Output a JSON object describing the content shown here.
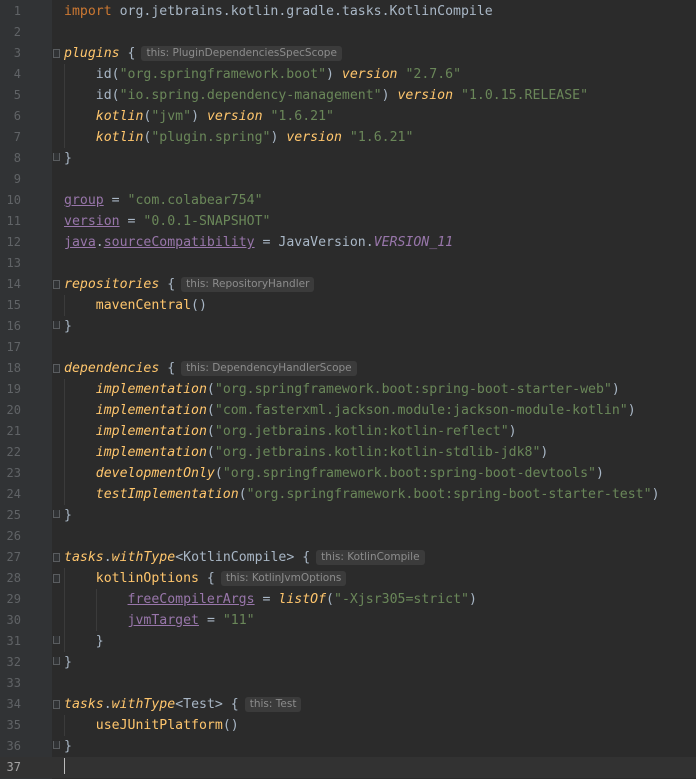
{
  "editor": {
    "caret_line": 37,
    "lines": [
      {
        "n": "1",
        "code": [
          {
            "t": "import",
            "c": "kw"
          },
          {
            "t": " org.jetbrains.kotlin.gradle.tasks.KotlinCompile"
          }
        ]
      },
      {
        "n": "2",
        "code": []
      },
      {
        "n": "3",
        "code": [
          {
            "t": "plugins",
            "c": "ext"
          },
          {
            "t": " {"
          }
        ],
        "hint": "this: PluginDependenciesSpecScope"
      },
      {
        "n": "4",
        "code": [
          {
            "t": "    id("
          },
          {
            "t": "\"org.springframework.boot\"",
            "c": "str"
          },
          {
            "t": ") "
          },
          {
            "t": "version",
            "c": "ext"
          },
          {
            "t": " "
          },
          {
            "t": "\"2.7.6\"",
            "c": "str"
          }
        ]
      },
      {
        "n": "5",
        "code": [
          {
            "t": "    id("
          },
          {
            "t": "\"io.spring.dependency-management\"",
            "c": "str"
          },
          {
            "t": ") "
          },
          {
            "t": "version",
            "c": "ext"
          },
          {
            "t": " "
          },
          {
            "t": "\"1.0.15.RELEASE\"",
            "c": "str"
          }
        ]
      },
      {
        "n": "6",
        "code": [
          {
            "t": "    "
          },
          {
            "t": "kotlin",
            "c": "ext"
          },
          {
            "t": "("
          },
          {
            "t": "\"jvm\"",
            "c": "str"
          },
          {
            "t": ") "
          },
          {
            "t": "version",
            "c": "ext"
          },
          {
            "t": " "
          },
          {
            "t": "\"1.6.21\"",
            "c": "str"
          }
        ]
      },
      {
        "n": "7",
        "code": [
          {
            "t": "    "
          },
          {
            "t": "kotlin",
            "c": "ext"
          },
          {
            "t": "("
          },
          {
            "t": "\"plugin.spring\"",
            "c": "str"
          },
          {
            "t": ") "
          },
          {
            "t": "version",
            "c": "ext"
          },
          {
            "t": " "
          },
          {
            "t": "\"1.6.21\"",
            "c": "str"
          }
        ]
      },
      {
        "n": "8",
        "code": [
          {
            "t": "}"
          }
        ]
      },
      {
        "n": "9",
        "code": []
      },
      {
        "n": "10",
        "code": [
          {
            "t": "group",
            "c": "prop"
          },
          {
            "t": " = "
          },
          {
            "t": "\"com.colabear754\"",
            "c": "str"
          }
        ]
      },
      {
        "n": "11",
        "code": [
          {
            "t": "version",
            "c": "prop"
          },
          {
            "t": " = "
          },
          {
            "t": "\"0.0.1-SNAPSHOT\"",
            "c": "str"
          }
        ]
      },
      {
        "n": "12",
        "code": [
          {
            "t": "java",
            "c": "prop"
          },
          {
            "t": "."
          },
          {
            "t": "sourceCompatibility",
            "c": "prop"
          },
          {
            "t": " = JavaVersion."
          },
          {
            "t": "VERSION_11",
            "c": "konst"
          }
        ]
      },
      {
        "n": "13",
        "code": []
      },
      {
        "n": "14",
        "code": [
          {
            "t": "repositories",
            "c": "ext"
          },
          {
            "t": " {"
          }
        ],
        "hint": "this: RepositoryHandler"
      },
      {
        "n": "15",
        "code": [
          {
            "t": "    "
          },
          {
            "t": "mavenCentral",
            "c": "fn"
          },
          {
            "t": "()"
          }
        ]
      },
      {
        "n": "16",
        "code": [
          {
            "t": "}"
          }
        ]
      },
      {
        "n": "17",
        "code": []
      },
      {
        "n": "18",
        "code": [
          {
            "t": "dependencies",
            "c": "ext"
          },
          {
            "t": " {"
          }
        ],
        "hint": "this: DependencyHandlerScope"
      },
      {
        "n": "19",
        "code": [
          {
            "t": "    "
          },
          {
            "t": "implementation",
            "c": "ext"
          },
          {
            "t": "("
          },
          {
            "t": "\"org.springframework.boot:spring-boot-starter-web\"",
            "c": "str"
          },
          {
            "t": ")"
          }
        ]
      },
      {
        "n": "20",
        "code": [
          {
            "t": "    "
          },
          {
            "t": "implementation",
            "c": "ext"
          },
          {
            "t": "("
          },
          {
            "t": "\"com.fasterxml.jackson.module:jackson-module-kotlin\"",
            "c": "str"
          },
          {
            "t": ")"
          }
        ]
      },
      {
        "n": "21",
        "code": [
          {
            "t": "    "
          },
          {
            "t": "implementation",
            "c": "ext"
          },
          {
            "t": "("
          },
          {
            "t": "\"org.jetbrains.kotlin:kotlin-reflect\"",
            "c": "str"
          },
          {
            "t": ")"
          }
        ]
      },
      {
        "n": "22",
        "code": [
          {
            "t": "    "
          },
          {
            "t": "implementation",
            "c": "ext"
          },
          {
            "t": "("
          },
          {
            "t": "\"org.jetbrains.kotlin:kotlin-stdlib-jdk8\"",
            "c": "str"
          },
          {
            "t": ")"
          }
        ]
      },
      {
        "n": "23",
        "code": [
          {
            "t": "    "
          },
          {
            "t": "developmentOnly",
            "c": "ext"
          },
          {
            "t": "("
          },
          {
            "t": "\"org.springframework.boot:spring-boot-devtools\"",
            "c": "str"
          },
          {
            "t": ")"
          }
        ]
      },
      {
        "n": "24",
        "code": [
          {
            "t": "    "
          },
          {
            "t": "testImplementation",
            "c": "ext"
          },
          {
            "t": "("
          },
          {
            "t": "\"org.springframework.boot:spring-boot-starter-test\"",
            "c": "str"
          },
          {
            "t": ")"
          }
        ]
      },
      {
        "n": "25",
        "code": [
          {
            "t": "}"
          }
        ]
      },
      {
        "n": "26",
        "code": []
      },
      {
        "n": "27",
        "code": [
          {
            "t": "tasks",
            "c": "ext"
          },
          {
            "t": "."
          },
          {
            "t": "withType",
            "c": "ext"
          },
          {
            "t": "<KotlinCompile> {"
          }
        ],
        "hint": "this: KotlinCompile"
      },
      {
        "n": "28",
        "code": [
          {
            "t": "    "
          },
          {
            "t": "kotlinOptions",
            "c": "fn"
          },
          {
            "t": " {"
          }
        ],
        "hint": "this: KotlinJvmOptions"
      },
      {
        "n": "29",
        "code": [
          {
            "t": "        "
          },
          {
            "t": "freeCompilerArgs",
            "c": "prop"
          },
          {
            "t": " = "
          },
          {
            "t": "listOf",
            "c": "ext"
          },
          {
            "t": "("
          },
          {
            "t": "\"-Xjsr305=strict\"",
            "c": "str"
          },
          {
            "t": ")"
          }
        ]
      },
      {
        "n": "30",
        "code": [
          {
            "t": "        "
          },
          {
            "t": "jvmTarget",
            "c": "prop"
          },
          {
            "t": " = "
          },
          {
            "t": "\"11\"",
            "c": "str"
          }
        ]
      },
      {
        "n": "31",
        "code": [
          {
            "t": "    }"
          }
        ]
      },
      {
        "n": "32",
        "code": [
          {
            "t": "}"
          }
        ]
      },
      {
        "n": "33",
        "code": []
      },
      {
        "n": "34",
        "code": [
          {
            "t": "tasks",
            "c": "ext"
          },
          {
            "t": "."
          },
          {
            "t": "withType",
            "c": "ext"
          },
          {
            "t": "<Test> {"
          }
        ],
        "hint": "this: Test"
      },
      {
        "n": "35",
        "code": [
          {
            "t": "    "
          },
          {
            "t": "useJUnitPlatform",
            "c": "fn"
          },
          {
            "t": "()"
          }
        ]
      },
      {
        "n": "36",
        "code": [
          {
            "t": "}"
          }
        ]
      },
      {
        "n": "37",
        "code": []
      }
    ]
  }
}
